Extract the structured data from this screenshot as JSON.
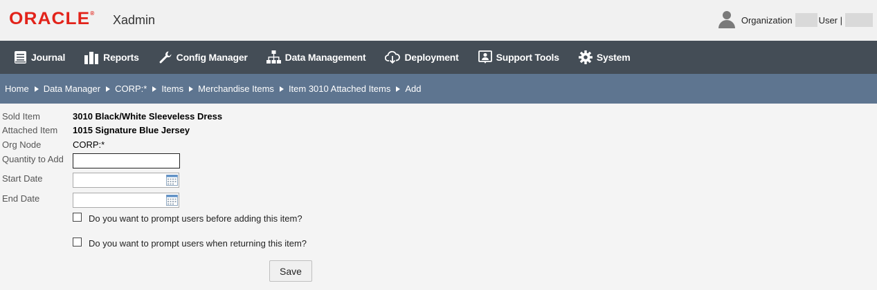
{
  "header": {
    "brand": "ORACLE",
    "app_name": "Xadmin",
    "organization_label": "Organization",
    "user_label": "User |"
  },
  "nav": {
    "items": [
      {
        "label": "Journal",
        "icon": "journal-icon"
      },
      {
        "label": "Reports",
        "icon": "reports-icon"
      },
      {
        "label": "Config Manager",
        "icon": "wrench-icon"
      },
      {
        "label": "Data Management",
        "icon": "hierarchy-icon"
      },
      {
        "label": "Deployment",
        "icon": "cloud-download-icon"
      },
      {
        "label": "Support Tools",
        "icon": "support-icon"
      },
      {
        "label": "System",
        "icon": "gear-icon"
      }
    ]
  },
  "breadcrumb": [
    "Home",
    "Data Manager",
    "CORP:*",
    "Items",
    "Merchandise Items",
    "Item 3010 Attached Items",
    "Add"
  ],
  "form": {
    "sold_item_label": "Sold Item",
    "sold_item_value": "3010 Black/White Sleeveless Dress",
    "attached_item_label": "Attached Item",
    "attached_item_value": "1015 Signature Blue Jersey",
    "org_node_label": "Org Node",
    "org_node_value": "CORP:*",
    "quantity_label": "Quantity to Add",
    "quantity_value": "",
    "start_date_label": "Start Date",
    "start_date_value": "",
    "end_date_label": "End Date",
    "end_date_value": "",
    "prompt_adding_label": "Do you want to prompt users before adding this item?",
    "prompt_adding_checked": false,
    "prompt_returning_label": "Do you want to prompt users when returning this item?",
    "prompt_returning_checked": false,
    "save_label": "Save"
  },
  "colors": {
    "brand_red": "#e2231a",
    "nav_bg": "#444d56",
    "breadcrumb_bg": "#5e7590",
    "page_bg": "#f4f4f4"
  }
}
